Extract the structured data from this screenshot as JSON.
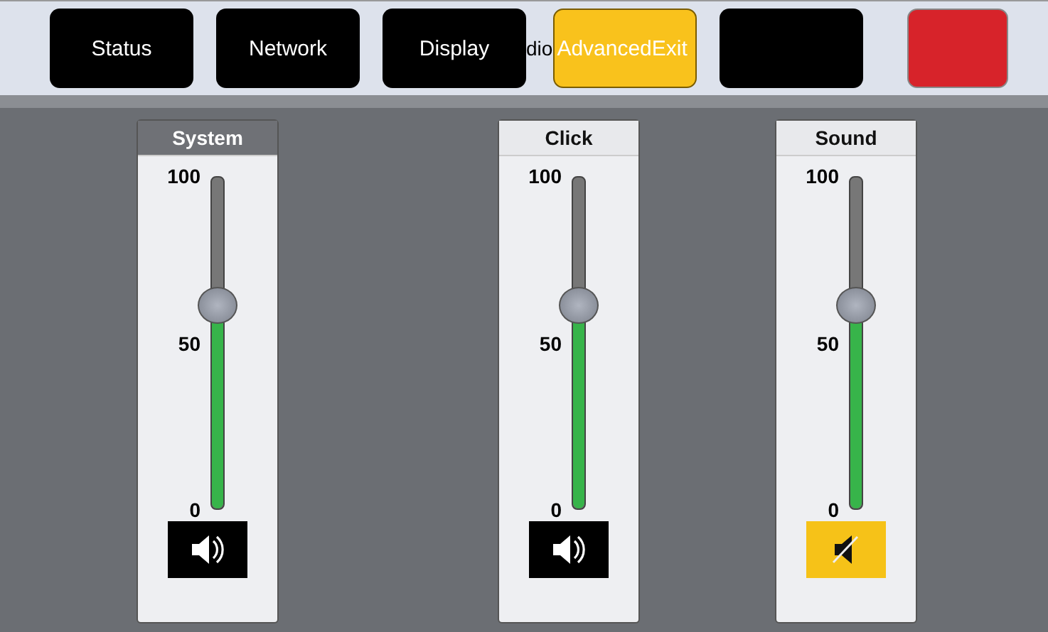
{
  "tabs": [
    {
      "kind": "tab",
      "label": "Status",
      "selected": false
    },
    {
      "kind": "tab",
      "label": "Network",
      "selected": false
    },
    {
      "kind": "tab",
      "label": "Display",
      "selected": false
    },
    {
      "kind": "stray",
      "label": "dio"
    },
    {
      "kind": "tab",
      "label": "AdvancedExit",
      "selected": true
    },
    {
      "kind": "tab",
      "selected": false
    },
    {
      "kind": "exit"
    }
  ],
  "channels": [
    {
      "name": "System",
      "selected": true,
      "level": 0.61,
      "muted": false,
      "ticks": [
        "100",
        "50",
        "0"
      ]
    },
    {
      "name": "Click",
      "selected": false,
      "level": 0.61,
      "muted": false,
      "ticks": [
        "100",
        "50",
        "0"
      ]
    },
    {
      "name": "Sound",
      "selected": false,
      "level": 0.61,
      "muted": true,
      "ticks": [
        "100",
        "50",
        "0"
      ]
    }
  ]
}
